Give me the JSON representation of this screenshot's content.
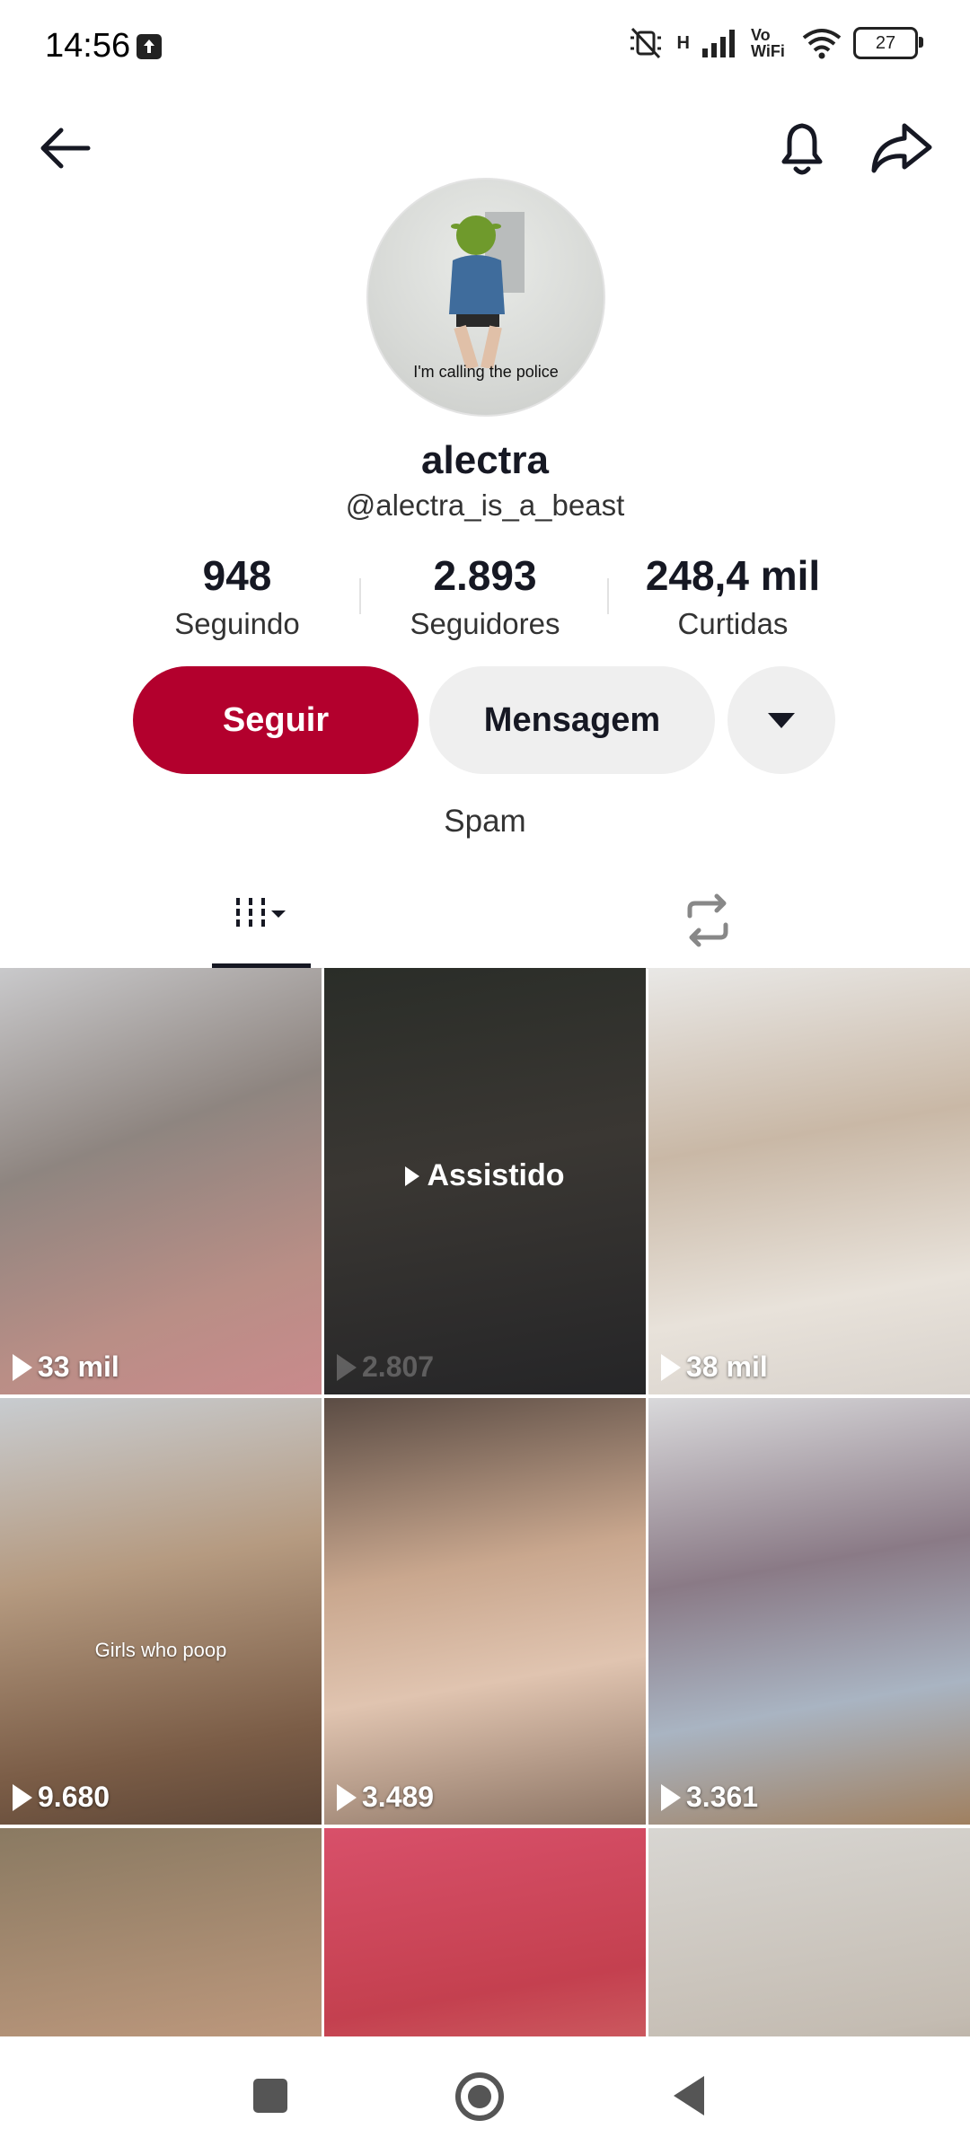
{
  "status_bar": {
    "time": "14:56",
    "network_label": "H",
    "volte_label": "Vo WiFi",
    "battery": "27"
  },
  "profile": {
    "avatar_caption": "I'm calling the police",
    "name": "alectra",
    "handle": "@alectra_is_a_beast",
    "stats": [
      {
        "value": "948",
        "label": "Seguindo"
      },
      {
        "value": "2.893",
        "label": "Seguidores"
      },
      {
        "value": "248,4 mil",
        "label": "Curtidas"
      }
    ],
    "follow_label": "Seguir",
    "message_label": "Mensagem",
    "bio": "Spam"
  },
  "videos": [
    {
      "views": "33 mil"
    },
    {
      "views": "2.807",
      "watched": "Assistido"
    },
    {
      "views": "38 mil"
    },
    {
      "views": "9.680",
      "overlay": "Girls who poop"
    },
    {
      "views": "3.489"
    },
    {
      "views": "3.361"
    },
    {
      "views": ""
    },
    {
      "views": ""
    },
    {
      "views": ""
    }
  ],
  "colors": {
    "follow_button": "#b3002d",
    "secondary_button": "#efefef",
    "text_primary": "#161823"
  }
}
